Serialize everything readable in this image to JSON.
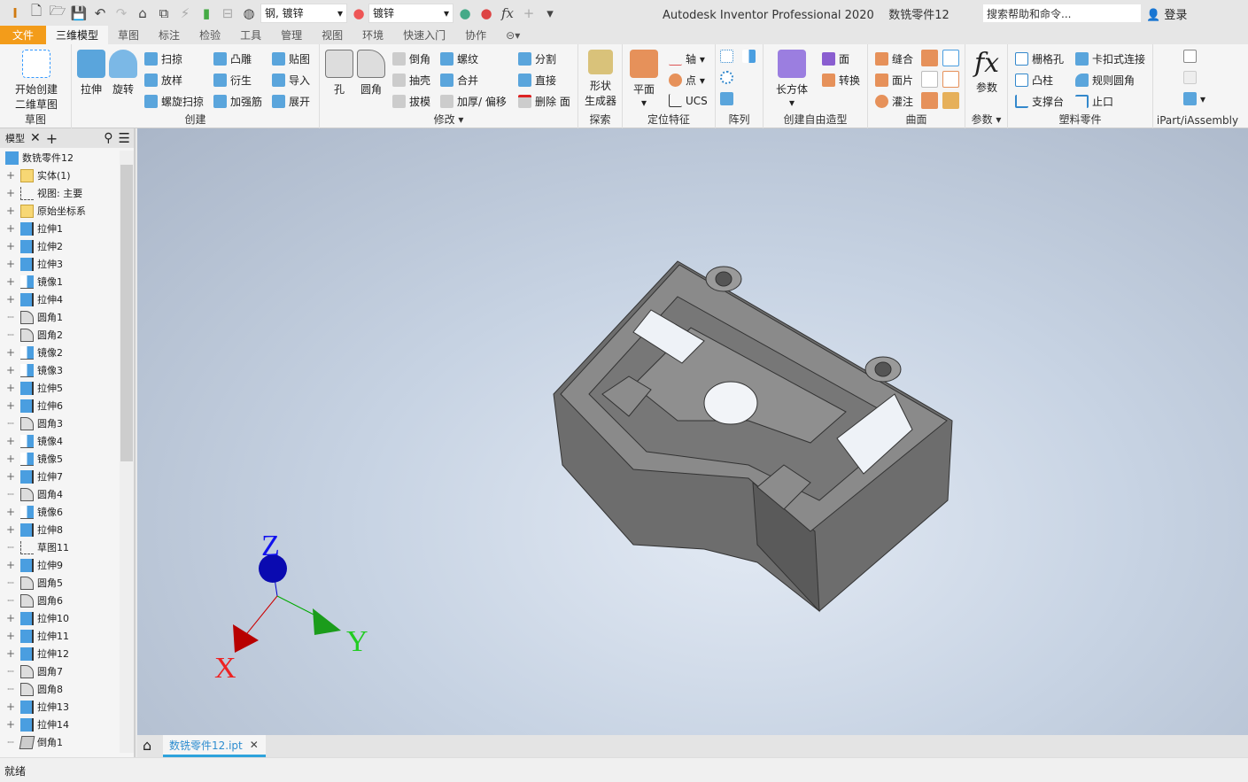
{
  "titlebar": {
    "app_title": "Autodesk Inventor Professional 2020",
    "doc_title": "数铣零件12",
    "material": "钢, 镀锌",
    "appearance": "镀锌",
    "search_placeholder": "搜索帮助和命令...",
    "login": "登录",
    "logo": "PRO"
  },
  "tabs": [
    "文件",
    "三维模型",
    "草图",
    "标注",
    "检验",
    "工具",
    "管理",
    "视图",
    "环境",
    "快速入门",
    "协作"
  ],
  "ribbon": {
    "sketch": {
      "title": "草图",
      "start": "开始创建",
      "start2": "二维草图"
    },
    "create": {
      "title": "创建",
      "extrude": "拉伸",
      "revolve": "旋转",
      "items": [
        "扫掠",
        "放样",
        "螺旋扫掠",
        "凸雕",
        "衍生",
        "加强筋",
        "贴图",
        "导入",
        "展开"
      ]
    },
    "modify": {
      "title": "修改",
      "hole": "孔",
      "fillet": "圆角",
      "items": [
        "倒角",
        "抽壳",
        "拔模",
        "螺纹",
        "合并",
        "加厚/ 偏移",
        "分割",
        "直接",
        "删除 面"
      ]
    },
    "explore": {
      "title": "探索",
      "shape": "形状",
      "shape2": "生成器"
    },
    "workfeat": {
      "title": "定位特征",
      "plane": "平面",
      "items": [
        "轴",
        "点",
        "UCS"
      ]
    },
    "pattern": {
      "title": "阵列"
    },
    "freeform": {
      "title": "创建自由造型",
      "box": "长方体",
      "items": [
        "面",
        "转换"
      ]
    },
    "surface": {
      "title": "曲面",
      "items": [
        "缝合",
        "面片",
        "灌注"
      ]
    },
    "params": {
      "title": "参数",
      "label": "参数"
    },
    "plastic": {
      "title": "塑料零件",
      "items": [
        "栅格孔",
        "凸柱",
        "支撑台",
        "卡扣式连接",
        "规则圆角",
        "止口"
      ]
    },
    "ipart": {
      "title": "iPart/iAssembly"
    }
  },
  "browser": {
    "tab": "模型",
    "root": "数铣零件12",
    "items": [
      {
        "label": "实体(1)",
        "icon": "folder-solid",
        "exp": true
      },
      {
        "label": "视图: 主要",
        "icon": "view",
        "exp": true
      },
      {
        "label": "原始坐标系",
        "icon": "folder",
        "exp": true
      },
      {
        "label": "拉伸1",
        "icon": "extrude",
        "exp": true
      },
      {
        "label": "拉伸2",
        "icon": "extrude",
        "exp": true
      },
      {
        "label": "拉伸3",
        "icon": "extrude",
        "exp": true
      },
      {
        "label": "镜像1",
        "icon": "mirror",
        "exp": true
      },
      {
        "label": "拉伸4",
        "icon": "extrude",
        "exp": true
      },
      {
        "label": "圆角1",
        "icon": "fillet",
        "exp": false
      },
      {
        "label": "圆角2",
        "icon": "fillet",
        "exp": false
      },
      {
        "label": "镜像2",
        "icon": "mirror",
        "exp": true
      },
      {
        "label": "镜像3",
        "icon": "mirror",
        "exp": true
      },
      {
        "label": "拉伸5",
        "icon": "extrude",
        "exp": true
      },
      {
        "label": "拉伸6",
        "icon": "extrude",
        "exp": true
      },
      {
        "label": "圆角3",
        "icon": "fillet",
        "exp": false
      },
      {
        "label": "镜像4",
        "icon": "mirror",
        "exp": true
      },
      {
        "label": "镜像5",
        "icon": "mirror",
        "exp": true
      },
      {
        "label": "拉伸7",
        "icon": "extrude",
        "exp": true
      },
      {
        "label": "圆角4",
        "icon": "fillet",
        "exp": false
      },
      {
        "label": "镜像6",
        "icon": "mirror",
        "exp": true
      },
      {
        "label": "拉伸8",
        "icon": "extrude",
        "exp": true
      },
      {
        "label": "草图11",
        "icon": "sketch",
        "exp": false
      },
      {
        "label": "拉伸9",
        "icon": "extrude",
        "exp": true
      },
      {
        "label": "圆角5",
        "icon": "fillet",
        "exp": false
      },
      {
        "label": "圆角6",
        "icon": "fillet",
        "exp": false
      },
      {
        "label": "拉伸10",
        "icon": "extrude",
        "exp": true
      },
      {
        "label": "拉伸11",
        "icon": "extrude",
        "exp": true
      },
      {
        "label": "拉伸12",
        "icon": "extrude",
        "exp": true
      },
      {
        "label": "圆角7",
        "icon": "fillet",
        "exp": false
      },
      {
        "label": "圆角8",
        "icon": "fillet",
        "exp": false
      },
      {
        "label": "拉伸13",
        "icon": "extrude",
        "exp": true
      },
      {
        "label": "拉伸14",
        "icon": "extrude",
        "exp": true
      },
      {
        "label": "倒角1",
        "icon": "chamfer",
        "exp": false
      }
    ]
  },
  "viewport": {
    "axis_x": "X",
    "axis_y": "Y",
    "axis_z": "Z",
    "colors": {
      "x": "#cc0000",
      "y": "#00aa00",
      "z": "#0000cc",
      "part": "#7a7a7a"
    }
  },
  "doctab": {
    "label": "数铣零件12.ipt"
  },
  "status": "就绪"
}
